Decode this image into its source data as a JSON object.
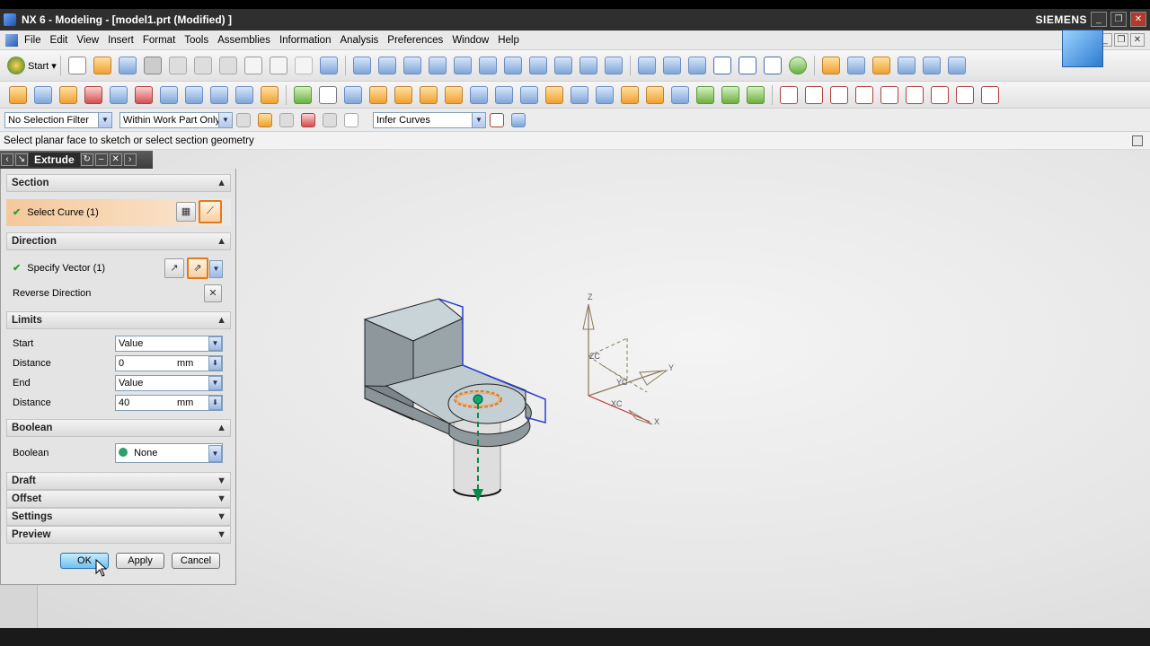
{
  "window": {
    "title": "NX 6 - Modeling - [model1.prt (Modified) ]",
    "brand": "SIEMENS"
  },
  "menu": {
    "items": [
      "File",
      "Edit",
      "View",
      "Insert",
      "Format",
      "Tools",
      "Assemblies",
      "Information",
      "Analysis",
      "Preferences",
      "Window",
      "Help"
    ],
    "mnemonics": [
      "F",
      "E",
      "V",
      "s",
      "r",
      "T",
      "A",
      "I",
      "l",
      "P",
      "W",
      "H"
    ]
  },
  "selection_bar": {
    "filter": "No Selection Filter",
    "scope": "Within Work Part Only",
    "curve_rule": "Infer Curves"
  },
  "cue_line": "Select planar face to sketch or select section geometry",
  "dialog": {
    "title": "Extrude",
    "section": {
      "header": "Section",
      "select_curve": "Select Curve (1)"
    },
    "direction": {
      "header": "Direction",
      "specify_vector": "Specify Vector (1)",
      "reverse": "Reverse Direction"
    },
    "limits": {
      "header": "Limits",
      "start_label": "Start",
      "start_value": "Value",
      "start_distance_label": "Distance",
      "start_distance": "0",
      "end_label": "End",
      "end_value": "Value",
      "end_distance_label": "Distance",
      "end_distance": "40",
      "unit": "mm"
    },
    "boolean": {
      "header": "Boolean",
      "label": "Boolean",
      "value": "None"
    },
    "collapsed_groups": [
      "Draft",
      "Offset",
      "Settings",
      "Preview"
    ],
    "buttons": {
      "ok": "OK",
      "apply": "Apply",
      "cancel": "Cancel"
    }
  },
  "triad": {
    "z": "Z",
    "y": "Y",
    "x": "X",
    "zc": "ZC",
    "yc": "YC",
    "xc": "XC"
  },
  "colors": {
    "highlight_orange": "#e07a1e",
    "check_green": "#2ea02e",
    "selection_blue": "#2a3fd0",
    "vector_green": "#0a8a4a"
  }
}
